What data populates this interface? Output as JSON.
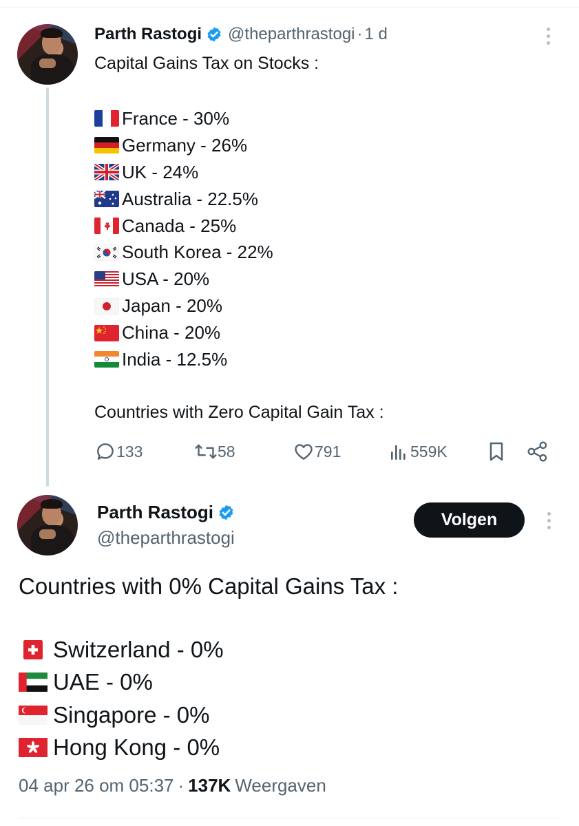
{
  "tweet1": {
    "author_name": "Parth Rastogi",
    "handle": "@theparthrastogi",
    "separator": "·",
    "time": "1 d",
    "title": "Capital Gains Tax on Stocks :",
    "items": [
      {
        "flag": "france-flag",
        "text": "France - 30%"
      },
      {
        "flag": "germany-flag",
        "text": "Germany - 26%"
      },
      {
        "flag": "uk-flag",
        "text": "UK - 24%"
      },
      {
        "flag": "australia-flag",
        "text": "Australia - 22.5%"
      },
      {
        "flag": "canada-flag",
        "text": "Canada - 25%"
      },
      {
        "flag": "south-korea-flag",
        "text": "South Korea - 22%"
      },
      {
        "flag": "usa-flag",
        "text": "USA - 20%"
      },
      {
        "flag": "japan-flag",
        "text": "Japan - 20%"
      },
      {
        "flag": "china-flag",
        "text": "China - 20%"
      },
      {
        "flag": "india-flag",
        "text": "India - 12.5%"
      }
    ],
    "zero_heading": "Countries with Zero Capital Gain Tax :",
    "actions": {
      "replies": "133",
      "reposts": "58",
      "likes": "791",
      "views": "559K"
    }
  },
  "tweet2": {
    "author_name": "Parth Rastogi",
    "handle": "@theparthrastogi",
    "follow_label": "Volgen",
    "title": "Countries with 0% Capital Gains Tax :",
    "items": [
      {
        "flag": "switzerland-flag",
        "text": "Switzerland - 0%"
      },
      {
        "flag": "uae-flag",
        "text": "UAE - 0%"
      },
      {
        "flag": "singapore-flag",
        "text": "Singapore - 0%"
      },
      {
        "flag": "hong-kong-flag",
        "text": "Hong Kong - 0%"
      }
    ],
    "timestamp": "04 apr 26 om 05:37",
    "meta_separator": "·",
    "view_count": "137K",
    "view_label": "Weergaven"
  },
  "colors": {
    "text": "#0f1419",
    "secondary": "#536471",
    "verified": "#1d9bf0",
    "thread_line": "#cfd9de",
    "button_bg": "#0f1419"
  }
}
